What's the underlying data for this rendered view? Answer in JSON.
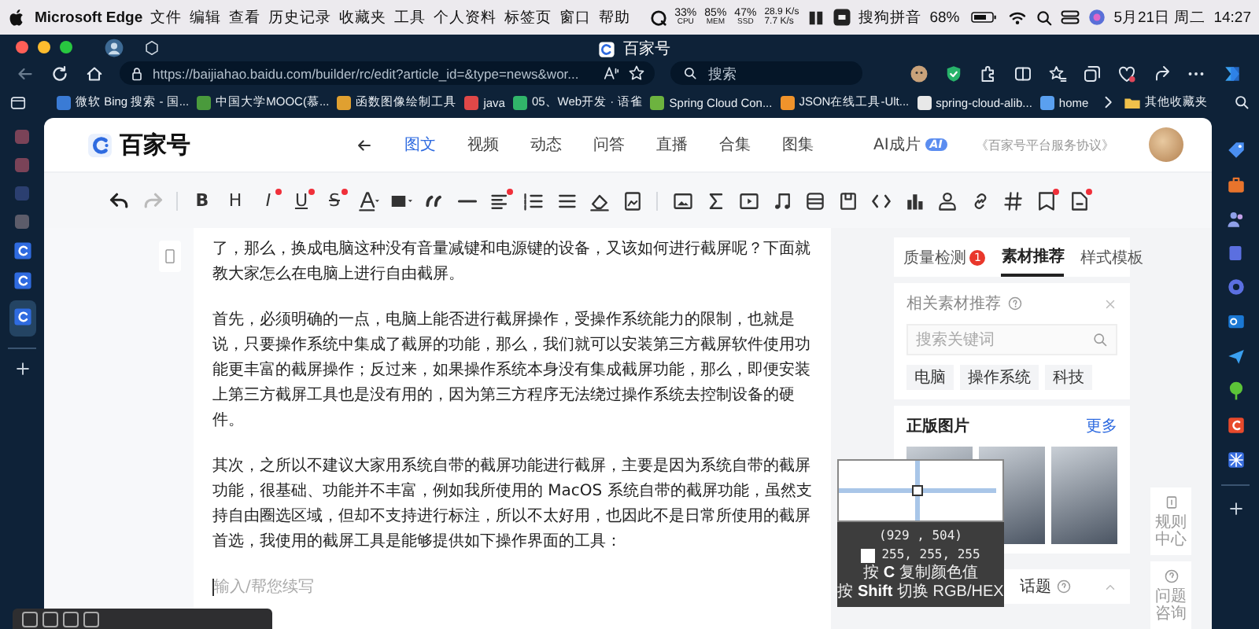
{
  "menubar": {
    "app": "Microsoft Edge",
    "menus": [
      "文件",
      "编辑",
      "查看",
      "历史记录",
      "收藏夹",
      "工具",
      "个人资料",
      "标签页",
      "窗口",
      "帮助"
    ],
    "stats": [
      {
        "value": "33%",
        "label": "CPU"
      },
      {
        "value": "85%",
        "label": "MEM"
      },
      {
        "value": "47%",
        "label": "SSD"
      }
    ],
    "network": [
      "28.9 K/s",
      "7.7 K/s"
    ],
    "input_method": "搜狗拼音",
    "battery": "68%",
    "date": "5月21日 周二",
    "time": "14:27"
  },
  "browser": {
    "tab_title": "百家号",
    "url": "https://baijiahao.baidu.com/builder/rc/edit?article_id=&type=news&wor...",
    "search": {
      "placeholder": "搜索"
    },
    "bookmarks": [
      {
        "label": "微软 Bing 搜索 - 国...",
        "color": "#3a7bd5"
      },
      {
        "label": "中国大学MOOC(慕...",
        "color": "#4a9a3c"
      },
      {
        "label": "函数图像绘制工具",
        "color": "#e0a030"
      },
      {
        "label": "java",
        "color": "#e04848"
      },
      {
        "label": "05、Web开发 · 语雀",
        "color": "#31b56a"
      },
      {
        "label": "Spring Cloud Con...",
        "color": "#6db33f"
      },
      {
        "label": "JSON在线工具-Ult...",
        "color": "#f0932b"
      },
      {
        "label": "spring-cloud-alib...",
        "color": "#e8e8e8"
      },
      {
        "label": "home",
        "color": "#5aa0f0"
      }
    ],
    "other_bookmarks": "其他收藏夹"
  },
  "page": {
    "logo": "百家号",
    "nav": [
      {
        "label": "图文",
        "selected": true
      },
      {
        "label": "视频",
        "selected": false
      },
      {
        "label": "动态",
        "selected": false
      },
      {
        "label": "问答",
        "selected": false
      },
      {
        "label": "直播",
        "selected": false
      },
      {
        "label": "合集",
        "selected": false
      },
      {
        "label": "图集",
        "selected": false
      },
      {
        "label": "AI成片",
        "selected": false,
        "badge": "AI"
      }
    ],
    "agreement": "《百家号平台服务协议》"
  },
  "toolbar": [
    {
      "kind": "icon",
      "new": false
    },
    {
      "kind": "icon",
      "new": false
    },
    {
      "kind": "divider"
    },
    {
      "kind": "bold",
      "label": "B",
      "new": false
    },
    {
      "kind": "heading",
      "label": "H",
      "new": false
    },
    {
      "kind": "italic",
      "label": "I",
      "new": true
    },
    {
      "kind": "underline",
      "label": "U",
      "new": true
    },
    {
      "kind": "strike",
      "label": "S",
      "new": true
    },
    {
      "kind": "icon",
      "new": false
    },
    {
      "kind": "icon",
      "new": false
    },
    {
      "kind": "icon",
      "new": false
    },
    {
      "kind": "icon",
      "new": false
    },
    {
      "kind": "icon",
      "new": true
    },
    {
      "kind": "icon",
      "new": false
    },
    {
      "kind": "icon",
      "new": false
    },
    {
      "kind": "icon",
      "new": false
    },
    {
      "kind": "icon",
      "new": false
    },
    {
      "kind": "divider"
    },
    {
      "kind": "icon",
      "new": false
    },
    {
      "kind": "icon",
      "new": false
    },
    {
      "kind": "icon",
      "new": false
    },
    {
      "kind": "icon",
      "new": false
    },
    {
      "kind": "icon",
      "new": false
    },
    {
      "kind": "icon",
      "new": false
    },
    {
      "kind": "icon",
      "new": false
    },
    {
      "kind": "icon",
      "new": false
    },
    {
      "kind": "icon",
      "new": false
    },
    {
      "kind": "icon",
      "new": false
    },
    {
      "kind": "icon",
      "new": false
    },
    {
      "kind": "icon",
      "new": true
    },
    {
      "kind": "icon",
      "new": true
    }
  ],
  "article": {
    "paragraphs": [
      "了，那么，换成电脑这种没有音量减键和电源键的设备，又该如何进行截屏呢？下面就教大家怎么在电脑上进行自由截屏。",
      "首先，必须明确的一点，电脑上能否进行截屏操作，受操作系统能力的限制，也就是说，只要操作系统中集成了截屏的功能，那么，我们就可以安装第三方截屏软件使用功能更丰富的截屏操作；反过来，如果操作系统本身没有集成截屏功能，那么，即便安装上第三方截屏工具也是没有用的，因为第三方程序无法绕过操作系统去控制设备的硬件。",
      "其次，之所以不建议大家用系统自带的截屏功能进行截屏，主要是因为系统自带的截屏功能，很基础、功能并不丰富，例如我所使用的 MacOS 系统自带的截屏功能，虽然支持自由圈选区域，但却不支持进行标注，所以不太好用，也因此不是日常所使用的截屏首选，我使用的截屏工具是能够提供如下操作界面的工具："
    ],
    "placeholder": "输入/帮您续写"
  },
  "panel": {
    "tabs": [
      {
        "label": "质量检测",
        "selected": false,
        "badge": "1"
      },
      {
        "label": "素材推荐",
        "selected": true
      },
      {
        "label": "样式模板",
        "selected": false
      }
    ],
    "recommend_title": "相关素材推荐",
    "search": {
      "placeholder": "搜索关键词"
    },
    "tags": [
      "电脑",
      "操作系统",
      "科技"
    ],
    "images_title": "正版图片",
    "more": "更多",
    "topic": "话题"
  },
  "float_buttons": [
    "规则中心",
    "问题咨询"
  ],
  "color_picker": {
    "coords": "(929 , 504)",
    "rgb": "255, 255, 255",
    "hints": [
      "按 **C** 复制颜色值",
      "按 **Shift** 切换 RGB/HEX"
    ]
  }
}
